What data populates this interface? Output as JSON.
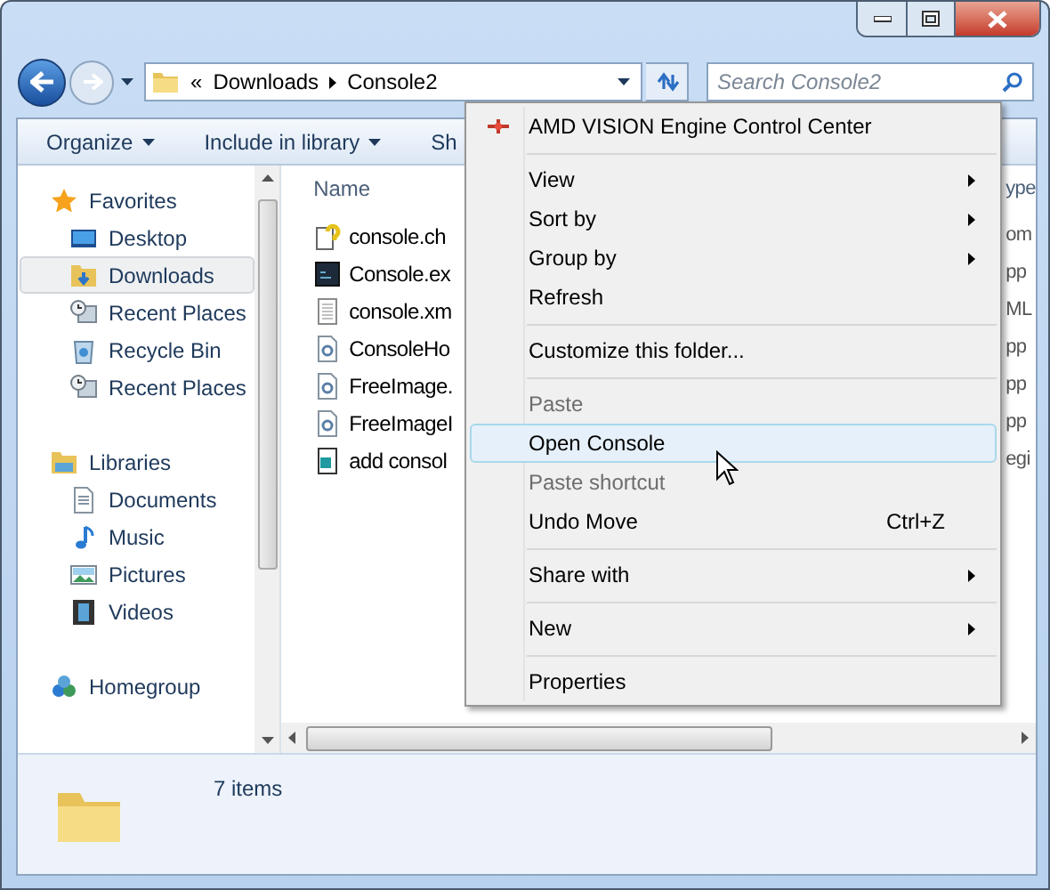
{
  "address_bar": {
    "overflow_mark": "«",
    "path": [
      {
        "label": "Downloads"
      },
      {
        "label": "Console2"
      }
    ]
  },
  "search": {
    "placeholder": "Search Console2"
  },
  "toolbar": {
    "items": [
      {
        "label": "Organize",
        "has_menu": true
      },
      {
        "label": "Include in library",
        "has_menu": true
      },
      {
        "label": "Sh",
        "has_menu": false
      }
    ]
  },
  "sidebar": {
    "groups": [
      {
        "label": "Favorites",
        "kind": "favorites",
        "children": [
          {
            "label": "Desktop",
            "kind": "desktop",
            "selected": false
          },
          {
            "label": "Downloads",
            "kind": "downloads",
            "selected": true
          },
          {
            "label": "Recent Places",
            "kind": "recent",
            "selected": false
          },
          {
            "label": "Recycle Bin",
            "kind": "recycle",
            "selected": false
          },
          {
            "label": "Recent Places",
            "kind": "recent",
            "selected": false
          }
        ]
      },
      {
        "label": "Libraries",
        "kind": "libraries",
        "children": [
          {
            "label": "Documents",
            "kind": "documents",
            "selected": false
          },
          {
            "label": "Music",
            "kind": "music",
            "selected": false
          },
          {
            "label": "Pictures",
            "kind": "pictures",
            "selected": false
          },
          {
            "label": "Videos",
            "kind": "videos",
            "selected": false
          }
        ]
      },
      {
        "label": "Homegroup",
        "kind": "homegroup"
      }
    ]
  },
  "file_list": {
    "columns": [
      {
        "label": "Name"
      },
      {
        "label": "ype"
      }
    ],
    "rows": [
      {
        "name": "console.ch",
        "column_2": "om",
        "kind": "help"
      },
      {
        "name": "Console.ex",
        "column_2": "pp",
        "kind": "console"
      },
      {
        "name": "console.xm",
        "column_2": "ML",
        "kind": "text"
      },
      {
        "name": "ConsoleHo",
        "column_2": "pp",
        "kind": "library"
      },
      {
        "name": "FreeImage.",
        "column_2": "pp",
        "kind": "library"
      },
      {
        "name": "FreeImageI",
        "column_2": "pp",
        "kind": "library"
      },
      {
        "name": "add consol",
        "column_2": "egi",
        "kind": "registry"
      }
    ]
  },
  "context_menu": {
    "items": [
      {
        "kind": "item",
        "label": "AMD VISION Engine Control Center",
        "has_icon": true,
        "disabled": false,
        "selected": false,
        "submenu": false
      },
      {
        "kind": "separator"
      },
      {
        "kind": "item",
        "label": "View",
        "has_icon": false,
        "disabled": false,
        "selected": false,
        "submenu": true
      },
      {
        "kind": "item",
        "label": "Sort by",
        "has_icon": false,
        "disabled": false,
        "selected": false,
        "submenu": true
      },
      {
        "kind": "item",
        "label": "Group by",
        "has_icon": false,
        "disabled": false,
        "selected": false,
        "submenu": true
      },
      {
        "kind": "item",
        "label": "Refresh",
        "has_icon": false,
        "disabled": false,
        "selected": false,
        "submenu": false
      },
      {
        "kind": "separator"
      },
      {
        "kind": "item",
        "label": "Customize this folder...",
        "has_icon": false,
        "disabled": false,
        "selected": false,
        "submenu": false
      },
      {
        "kind": "separator"
      },
      {
        "kind": "item",
        "label": "Paste",
        "has_icon": false,
        "disabled": true,
        "selected": false,
        "submenu": false
      },
      {
        "kind": "item",
        "label": "Open Console",
        "has_icon": false,
        "disabled": false,
        "selected": true,
        "submenu": false
      },
      {
        "kind": "item",
        "label": "Paste shortcut",
        "has_icon": false,
        "disabled": true,
        "selected": false,
        "submenu": false
      },
      {
        "kind": "item",
        "label": "Undo Move",
        "shortcut": "Ctrl+Z",
        "has_icon": false,
        "disabled": false,
        "selected": false,
        "submenu": false
      },
      {
        "kind": "separator"
      },
      {
        "kind": "item",
        "label": "Share with",
        "has_icon": false,
        "disabled": false,
        "selected": false,
        "submenu": true
      },
      {
        "kind": "separator"
      },
      {
        "kind": "item",
        "label": "New",
        "has_icon": false,
        "disabled": false,
        "selected": false,
        "submenu": true
      },
      {
        "kind": "separator"
      },
      {
        "kind": "item",
        "label": "Properties",
        "has_icon": false,
        "disabled": false,
        "selected": false,
        "submenu": false
      }
    ]
  },
  "status": {
    "item_count": "7 items"
  }
}
